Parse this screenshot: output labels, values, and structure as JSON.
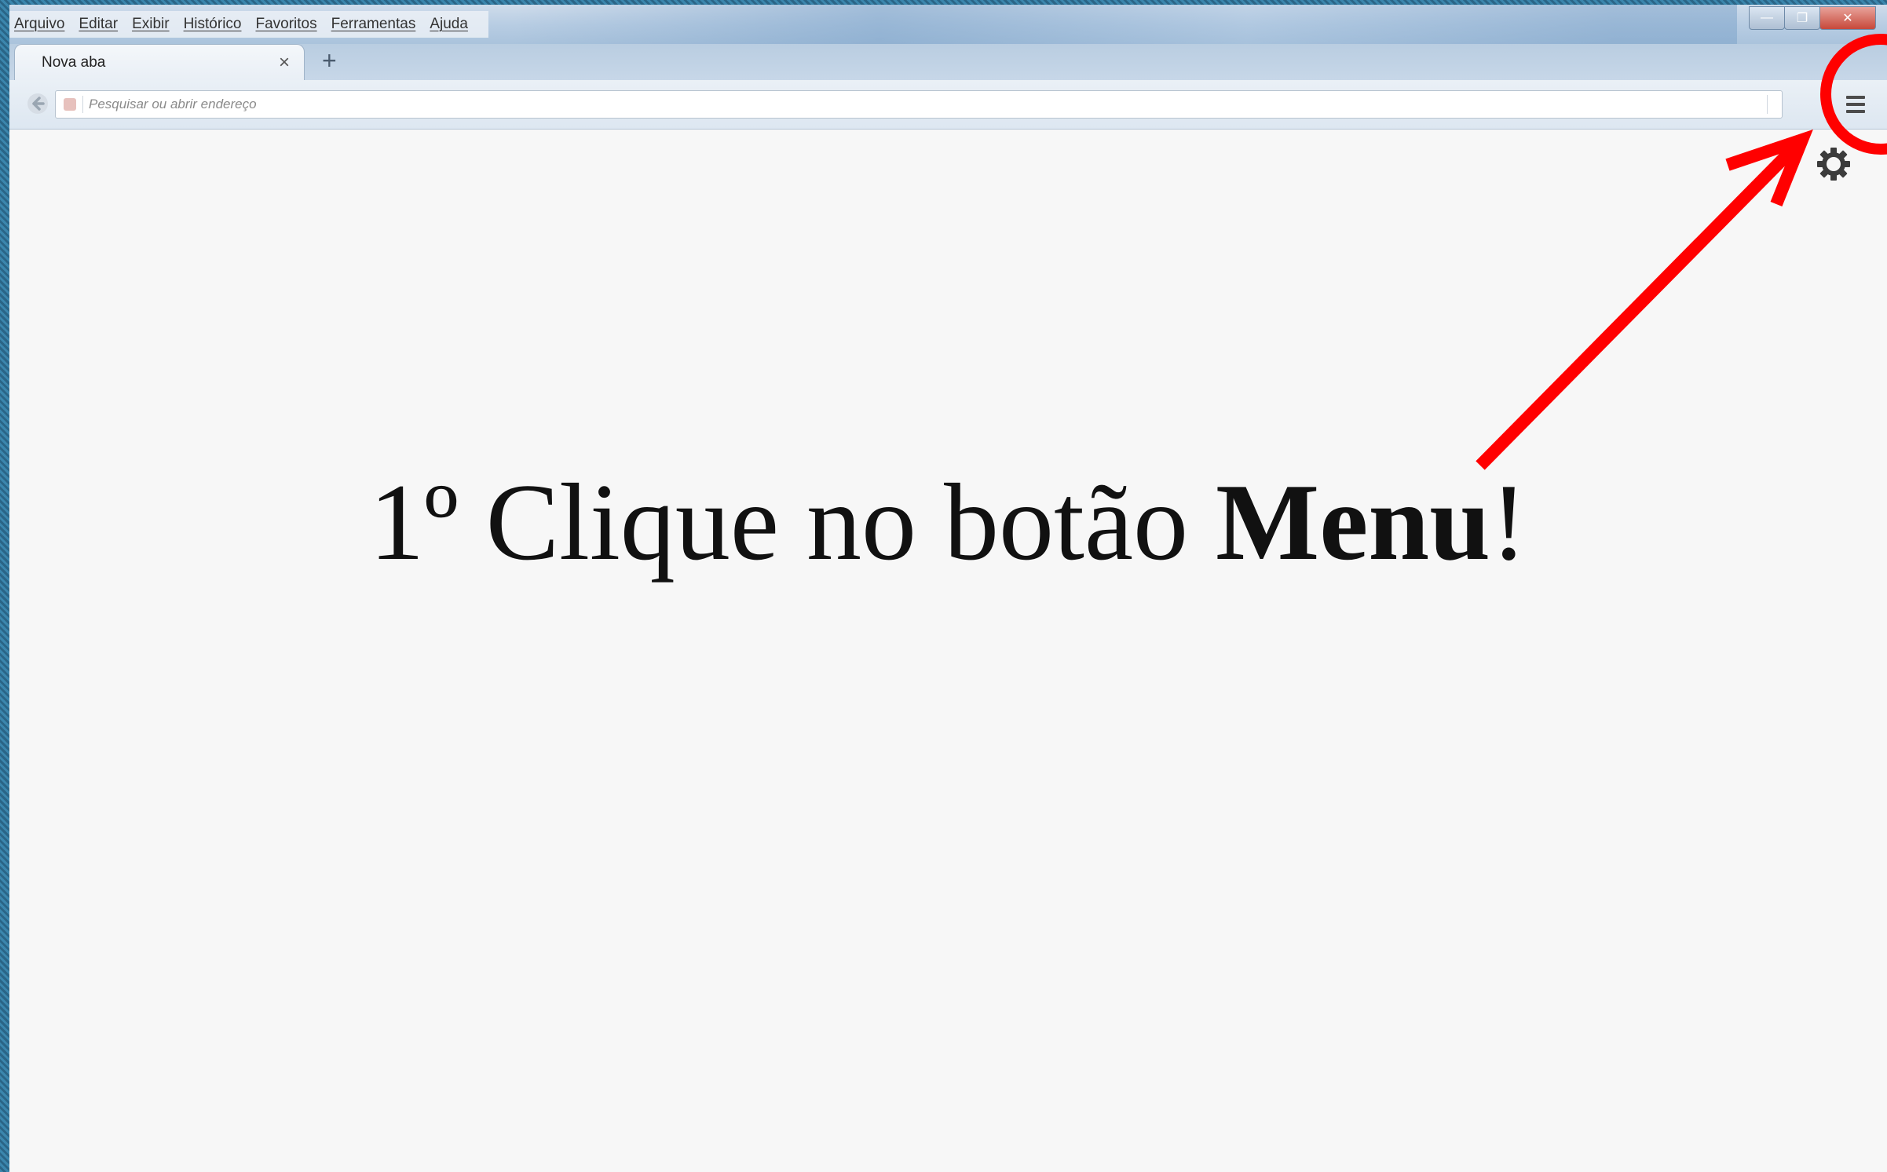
{
  "menubar": {
    "items": [
      "Arquivo",
      "Editar",
      "Exibir",
      "Histórico",
      "Favoritos",
      "Ferramentas",
      "Ajuda"
    ]
  },
  "window_controls": {
    "minimize": "—",
    "restore": "❐",
    "close": "✕"
  },
  "tabs": [
    {
      "label": "Nova aba",
      "close": "×"
    }
  ],
  "new_tab": "+",
  "navbar": {
    "url_placeholder": "Pesquisar ou abrir endereço"
  },
  "content": {
    "instruction_prefix": "1º Clique no botão ",
    "instruction_bold": "Menu",
    "instruction_suffix": "!"
  },
  "annotation_color": "#ff0000",
  "icons": [
    "back-arrow-icon",
    "site-identity-icon",
    "hamburger-menu-icon",
    "gear-icon"
  ]
}
